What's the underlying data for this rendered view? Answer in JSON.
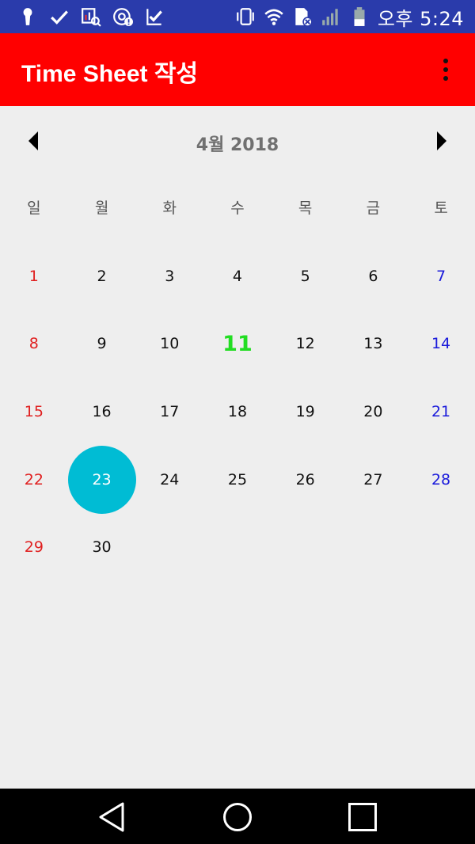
{
  "status_bar": {
    "time": "오후 5:24",
    "left_icons": [
      "keyhole-icon",
      "check-icon",
      "chart-search-icon",
      "at-sign-icon",
      "download-check-icon"
    ],
    "right_icons": [
      "vibrate-icon",
      "wifi-icon",
      "sim-error-icon",
      "signal-icon",
      "battery-icon"
    ]
  },
  "app_bar": {
    "title": "Time Sheet 작성",
    "color": "#ff0000"
  },
  "calendar": {
    "month_label": "4월 2018",
    "weekdays": [
      "일",
      "월",
      "화",
      "수",
      "목",
      "금",
      "토"
    ],
    "weeks": [
      [
        "1",
        "2",
        "3",
        "4",
        "5",
        "6",
        "7"
      ],
      [
        "8",
        "9",
        "10",
        "11",
        "12",
        "13",
        "14"
      ],
      [
        "15",
        "16",
        "17",
        "18",
        "19",
        "20",
        "21"
      ],
      [
        "22",
        "23",
        "24",
        "25",
        "26",
        "27",
        "28"
      ],
      [
        "29",
        "30",
        "",
        "",
        "",
        "",
        ""
      ]
    ],
    "today": "11",
    "selected": "23",
    "colors": {
      "sunday": "#e02020",
      "saturday": "#1a1adb",
      "today": "#22dd22",
      "selected_bg": "#00bcd4"
    }
  }
}
